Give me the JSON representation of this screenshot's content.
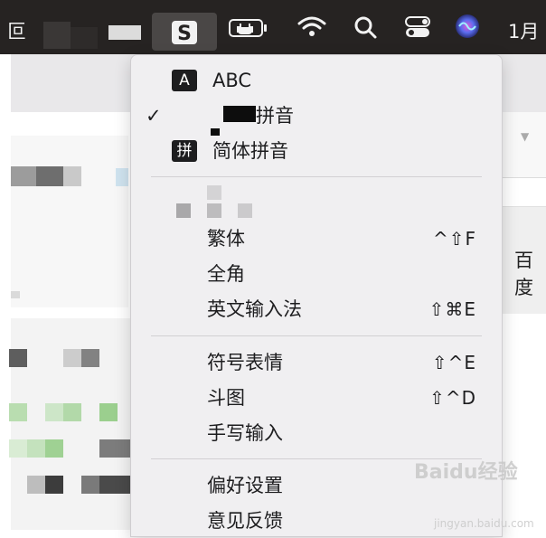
{
  "menubar": {
    "left_char": "叵",
    "clock_text": "1月",
    "icons": [
      "input-method-sogou-icon",
      "battery-charging-icon",
      "wifi-icon",
      "spotlight-search-icon",
      "control-center-icon",
      "siri-icon"
    ]
  },
  "menu": {
    "sources": [
      {
        "icon_char": "A",
        "label": "ABC",
        "checked": false
      },
      {
        "icon_char": "",
        "label": "拼音",
        "checked": true
      },
      {
        "icon_char": "拼",
        "label": "简体拼音",
        "checked": false
      }
    ],
    "check_mark": "✓",
    "items_group1": [
      {
        "label": "繁体",
        "shortcut": "^⇧F"
      },
      {
        "label": "全角",
        "shortcut": ""
      },
      {
        "label": "英文输入法",
        "shortcut": "⇧⌘E"
      }
    ],
    "items_group2": [
      {
        "label": "符号表情",
        "shortcut": "⇧^E"
      },
      {
        "label": "斗图",
        "shortcut": "⇧^D"
      },
      {
        "label": "手写输入",
        "shortcut": ""
      }
    ],
    "items_group3": [
      {
        "label": "偏好设置",
        "shortcut": ""
      },
      {
        "label": "意见反馈",
        "shortcut": ""
      }
    ]
  },
  "background": {
    "panel_text": "百度"
  },
  "watermark": {
    "main": "Baidu经验",
    "sub": "jingyan.baidu.com"
  }
}
